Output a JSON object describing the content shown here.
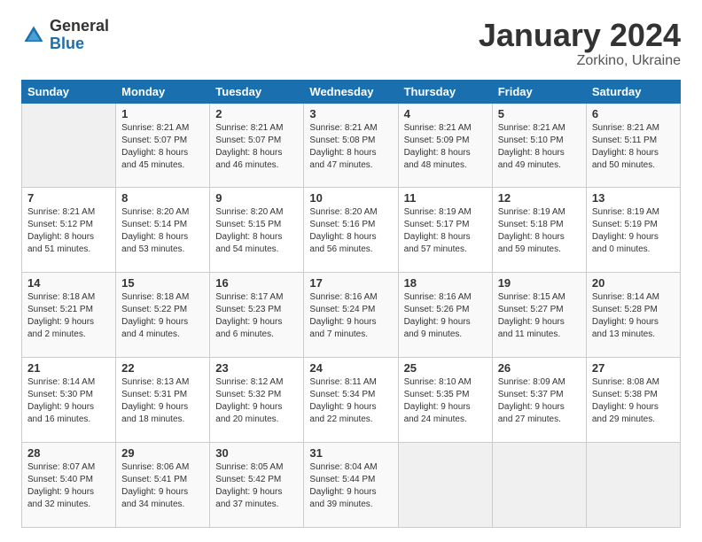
{
  "header": {
    "title": "January 2024",
    "subtitle": "Zorkino, Ukraine"
  },
  "dayHeaders": [
    "Sunday",
    "Monday",
    "Tuesday",
    "Wednesday",
    "Thursday",
    "Friday",
    "Saturday"
  ],
  "weeks": [
    [
      {
        "day": "",
        "sunrise": "",
        "sunset": "",
        "daylight": ""
      },
      {
        "day": "1",
        "sunrise": "8:21 AM",
        "sunset": "5:07 PM",
        "daylight": "8 hours and 45 minutes."
      },
      {
        "day": "2",
        "sunrise": "8:21 AM",
        "sunset": "5:07 PM",
        "daylight": "8 hours and 46 minutes."
      },
      {
        "day": "3",
        "sunrise": "8:21 AM",
        "sunset": "5:08 PM",
        "daylight": "8 hours and 47 minutes."
      },
      {
        "day": "4",
        "sunrise": "8:21 AM",
        "sunset": "5:09 PM",
        "daylight": "8 hours and 48 minutes."
      },
      {
        "day": "5",
        "sunrise": "8:21 AM",
        "sunset": "5:10 PM",
        "daylight": "8 hours and 49 minutes."
      },
      {
        "day": "6",
        "sunrise": "8:21 AM",
        "sunset": "5:11 PM",
        "daylight": "8 hours and 50 minutes."
      }
    ],
    [
      {
        "day": "7",
        "sunrise": "8:21 AM",
        "sunset": "5:12 PM",
        "daylight": "8 hours and 51 minutes."
      },
      {
        "day": "8",
        "sunrise": "8:20 AM",
        "sunset": "5:14 PM",
        "daylight": "8 hours and 53 minutes."
      },
      {
        "day": "9",
        "sunrise": "8:20 AM",
        "sunset": "5:15 PM",
        "daylight": "8 hours and 54 minutes."
      },
      {
        "day": "10",
        "sunrise": "8:20 AM",
        "sunset": "5:16 PM",
        "daylight": "8 hours and 56 minutes."
      },
      {
        "day": "11",
        "sunrise": "8:19 AM",
        "sunset": "5:17 PM",
        "daylight": "8 hours and 57 minutes."
      },
      {
        "day": "12",
        "sunrise": "8:19 AM",
        "sunset": "5:18 PM",
        "daylight": "8 hours and 59 minutes."
      },
      {
        "day": "13",
        "sunrise": "8:19 AM",
        "sunset": "5:19 PM",
        "daylight": "9 hours and 0 minutes."
      }
    ],
    [
      {
        "day": "14",
        "sunrise": "8:18 AM",
        "sunset": "5:21 PM",
        "daylight": "9 hours and 2 minutes."
      },
      {
        "day": "15",
        "sunrise": "8:18 AM",
        "sunset": "5:22 PM",
        "daylight": "9 hours and 4 minutes."
      },
      {
        "day": "16",
        "sunrise": "8:17 AM",
        "sunset": "5:23 PM",
        "daylight": "9 hours and 6 minutes."
      },
      {
        "day": "17",
        "sunrise": "8:16 AM",
        "sunset": "5:24 PM",
        "daylight": "9 hours and 7 minutes."
      },
      {
        "day": "18",
        "sunrise": "8:16 AM",
        "sunset": "5:26 PM",
        "daylight": "9 hours and 9 minutes."
      },
      {
        "day": "19",
        "sunrise": "8:15 AM",
        "sunset": "5:27 PM",
        "daylight": "9 hours and 11 minutes."
      },
      {
        "day": "20",
        "sunrise": "8:14 AM",
        "sunset": "5:28 PM",
        "daylight": "9 hours and 13 minutes."
      }
    ],
    [
      {
        "day": "21",
        "sunrise": "8:14 AM",
        "sunset": "5:30 PM",
        "daylight": "9 hours and 16 minutes."
      },
      {
        "day": "22",
        "sunrise": "8:13 AM",
        "sunset": "5:31 PM",
        "daylight": "9 hours and 18 minutes."
      },
      {
        "day": "23",
        "sunrise": "8:12 AM",
        "sunset": "5:32 PM",
        "daylight": "9 hours and 20 minutes."
      },
      {
        "day": "24",
        "sunrise": "8:11 AM",
        "sunset": "5:34 PM",
        "daylight": "9 hours and 22 minutes."
      },
      {
        "day": "25",
        "sunrise": "8:10 AM",
        "sunset": "5:35 PM",
        "daylight": "9 hours and 24 minutes."
      },
      {
        "day": "26",
        "sunrise": "8:09 AM",
        "sunset": "5:37 PM",
        "daylight": "9 hours and 27 minutes."
      },
      {
        "day": "27",
        "sunrise": "8:08 AM",
        "sunset": "5:38 PM",
        "daylight": "9 hours and 29 minutes."
      }
    ],
    [
      {
        "day": "28",
        "sunrise": "8:07 AM",
        "sunset": "5:40 PM",
        "daylight": "9 hours and 32 minutes."
      },
      {
        "day": "29",
        "sunrise": "8:06 AM",
        "sunset": "5:41 PM",
        "daylight": "9 hours and 34 minutes."
      },
      {
        "day": "30",
        "sunrise": "8:05 AM",
        "sunset": "5:42 PM",
        "daylight": "9 hours and 37 minutes."
      },
      {
        "day": "31",
        "sunrise": "8:04 AM",
        "sunset": "5:44 PM",
        "daylight": "9 hours and 39 minutes."
      },
      {
        "day": "",
        "sunrise": "",
        "sunset": "",
        "daylight": ""
      },
      {
        "day": "",
        "sunrise": "",
        "sunset": "",
        "daylight": ""
      },
      {
        "day": "",
        "sunrise": "",
        "sunset": "",
        "daylight": ""
      }
    ]
  ],
  "labels": {
    "sunrise": "Sunrise:",
    "sunset": "Sunset:",
    "daylight": "Daylight:"
  }
}
